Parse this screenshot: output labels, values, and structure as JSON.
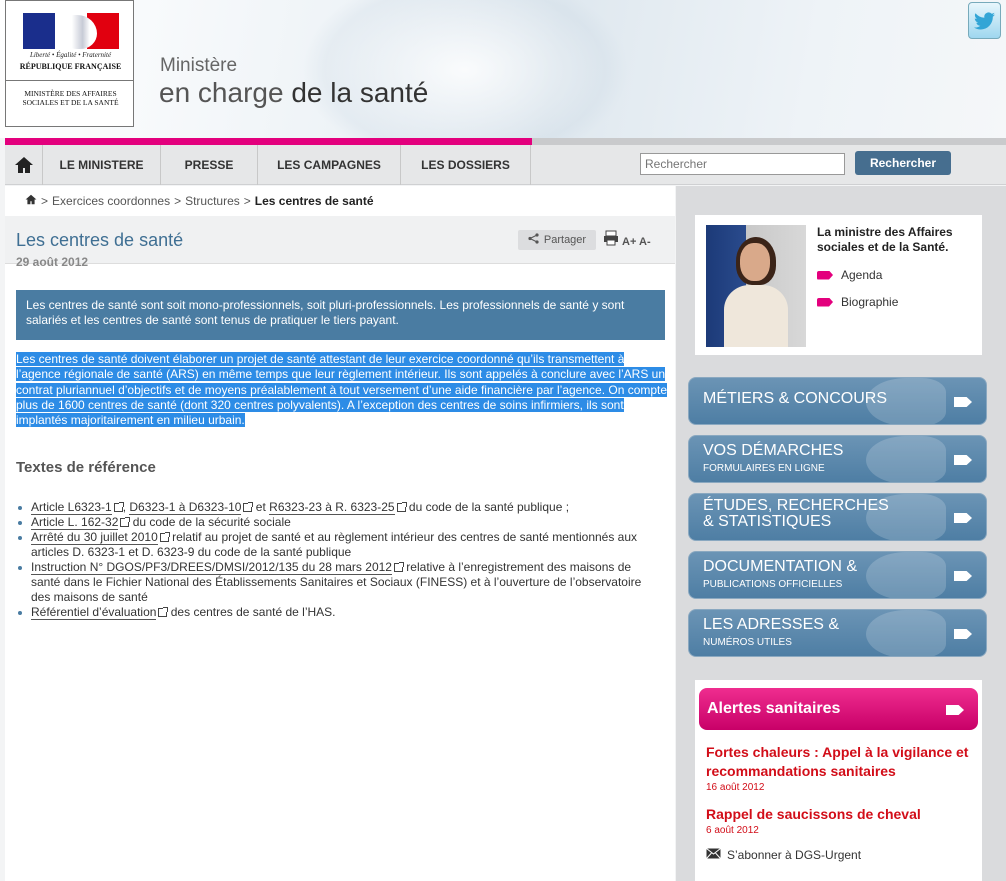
{
  "header": {
    "logo_devise": "Liberté • Égalité • Fraternité",
    "logo_republique": "RÉPUBLIQUE FRANÇAISE",
    "logo_ministere": "MINISTÈRE DES AFFAIRES SOCIALES ET DE LA SANTÉ",
    "title_line1": "Ministère",
    "title_line2_a": "en charge ",
    "title_line2_b": "de la santé"
  },
  "nav": {
    "items": [
      "LE MINISTERE",
      "PRESSE",
      "LES CAMPAGNES",
      "LES DOSSIERS"
    ],
    "search_placeholder": "Rechercher",
    "search_button": "Rechercher"
  },
  "breadcrumb": {
    "items": [
      "Exercices coordonnes",
      "Structures"
    ],
    "current": "Les centres de santé"
  },
  "article": {
    "title": "Les centres de santé",
    "date": "29 août 2012",
    "share_label": "Partager",
    "font_size_label": "A+ A-",
    "chapo": "Les centres de santé sont soit mono-professionnels, soit pluri-professionnels. Les professionnels de santé y sont salariés et les centres de santé sont tenus de pratiquer le tiers payant.",
    "body": "Les centres de santé doivent élaborer un projet de santé attestant de leur exercice coordonné qu’ils transmettent à l’agence régionale de santé (ARS) en même temps que leur règlement intérieur. Ils sont appelés à conclure avec l’ARS un contrat pluriannuel d’objectifs et de moyens préalablement à tout versement d’une aide financière par l’agence. On compte plus de 1600 centres de santé (dont 320 centres polyvalents). A l’exception des centres de soins infirmiers, ils sont implantés majoritairement en milieu urbain.",
    "refs_title": "Textes de référence",
    "refs": {
      "r1_l1": "Article L6323-1",
      "r1_s1": ", ",
      "r1_l2": "D6323-1 à D6323-10",
      "r1_s2": " et ",
      "r1_l3": "R6323-23 à R. 6323-25",
      "r1_end": " du code de la santé publique ;",
      "r2_l1": "Article L. 162-32",
      "r2_end": " du code de la sécurité sociale",
      "r3_l1": "Arrêté du 30 juillet 2010",
      "r3_end": " relatif au projet de santé et au règlement intérieur des centres de santé mentionnés aux articles D. 6323-1 et D. 6323-9 du code de la santé publique",
      "r4_l1": "Instruction N° DGOS/PF3/DREES/DMSI/2012/135 du 28 mars 2012",
      "r4_end": " relative à l’enregistrement des maisons de santé dans le Fichier National des Établissements Sanitaires et Sociaux (FINESS) et à l’ouverture de l’observatoire des maisons de santé",
      "r5_l1": "Référentiel d’évaluation",
      "r5_end": " des centres de santé de l’HAS."
    }
  },
  "sidebar": {
    "minister_title": "La ministre des Affaires sociales et de la Santé.",
    "links": [
      "Agenda",
      "Biographie"
    ],
    "buttons": [
      {
        "t1": "MÉTIERS & CONCOURS",
        "t2": ""
      },
      {
        "t1": "VOS DÉMARCHES",
        "t2": "FORMULAIRES EN LIGNE"
      },
      {
        "t1": "ÉTUDES, RECHERCHES & STATISTIQUES",
        "t2": ""
      },
      {
        "t1": "DOCUMENTATION &",
        "t2": "PUBLICATIONS OFFICIELLES"
      },
      {
        "t1": "LES ADRESSES &",
        "t2": "NUMÉROS UTILES"
      }
    ],
    "alerts_title": "Alertes sanitaires",
    "alerts": [
      {
        "title": "Fortes chaleurs : Appel à la vigilance et recommandations sanitaires",
        "date": "16 août 2012"
      },
      {
        "title": "Rappel de saucissons de cheval",
        "date": "6 août 2012"
      }
    ],
    "subscribe": "S’abonner à DGS-Urgent"
  },
  "colors": {
    "accent_pink": "#e3007d",
    "accent_blue": "#4a7ca2",
    "alert_red": "#d20d18"
  },
  "icons": [
    "home-icon",
    "share-icon",
    "print-icon",
    "twitter-icon",
    "external-link-icon",
    "envelope-icon",
    "arrow-tag-icon"
  ]
}
